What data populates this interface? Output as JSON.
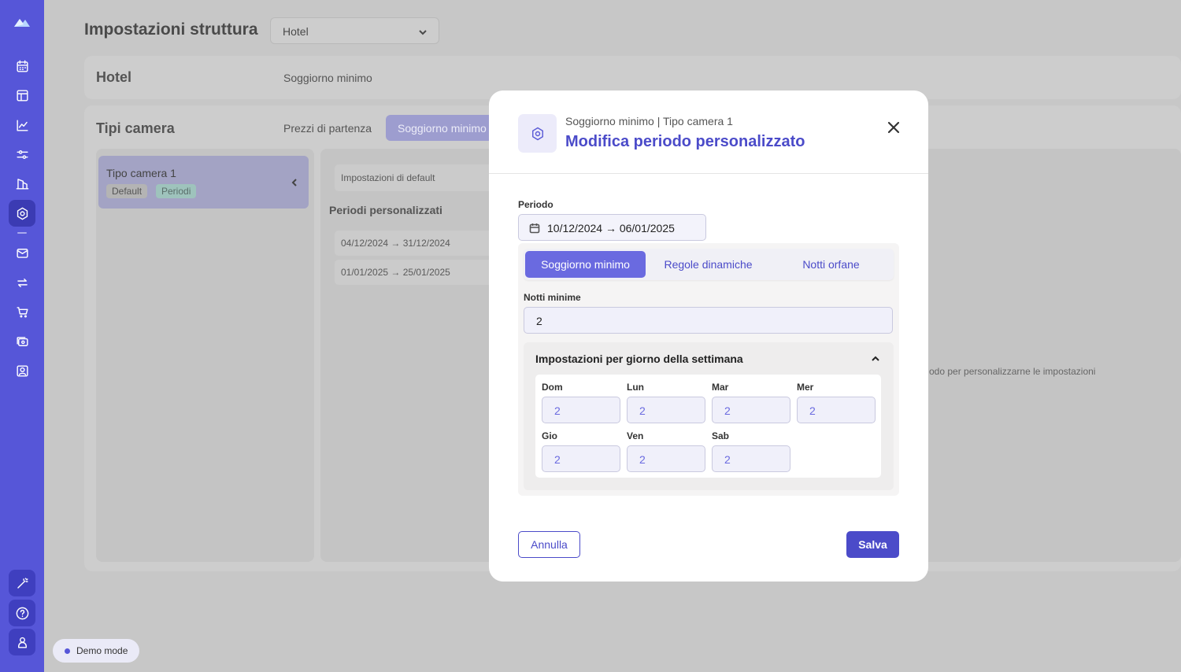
{
  "page": {
    "title": "Impostazioni struttura",
    "property_select": "Hotel"
  },
  "hotel_card": {
    "title": "Hotel",
    "link": "Soggiorno minimo"
  },
  "room_types_card": {
    "title": "Tipi camera",
    "tabs": [
      "Prezzi di partenza",
      "Soggiorno minimo"
    ],
    "room": {
      "name": "Tipo camera 1",
      "badges": [
        "Default",
        "Periodi"
      ]
    },
    "default_settings": "Impostazioni di default",
    "custom_periods_label": "Periodi personalizzati",
    "periods": [
      "04/12/2024 → 31/12/2024",
      "01/01/2025 → 25/01/2025"
    ],
    "empty_hint": "odo per personalizzarne le impostazioni"
  },
  "demo": {
    "label": "Demo mode"
  },
  "modal": {
    "subtitle": "Soggiorno minimo | Tipo camera 1",
    "title": "Modifica periodo personalizzato",
    "period_label": "Periodo",
    "period_value": "10/12/2024 → 06/01/2025",
    "tabs": [
      "Soggiorno minimo",
      "Regole dinamiche",
      "Notti orfane"
    ],
    "min_nights_label": "Notti minime",
    "min_nights_value": "2",
    "weekday_section_title": "Impostazioni per giorno della settimana",
    "days": [
      {
        "label": "Dom",
        "value": "2"
      },
      {
        "label": "Lun",
        "value": "2"
      },
      {
        "label": "Mar",
        "value": "2"
      },
      {
        "label": "Mer",
        "value": "2"
      },
      {
        "label": "Gio",
        "value": "2"
      },
      {
        "label": "Ven",
        "value": "2"
      },
      {
        "label": "Sab",
        "value": "2"
      }
    ],
    "cancel_label": "Annulla",
    "save_label": "Salva"
  },
  "colors": {
    "sidebar": "#5656d8",
    "accent": "#4b4bc9",
    "active_tab": "#6a6ae0",
    "overlay_bg": "#c7c7c7"
  },
  "icons": {
    "sidebar": [
      "logo-icon",
      "calendar-icon",
      "layout-icon",
      "chart-icon",
      "sliders-icon",
      "building-icon",
      "settings-icon",
      "mail-icon",
      "sync-icon",
      "cart-icon",
      "channels-icon",
      "contact-icon",
      "magic-wand-icon",
      "help-icon",
      "user-icon"
    ]
  }
}
